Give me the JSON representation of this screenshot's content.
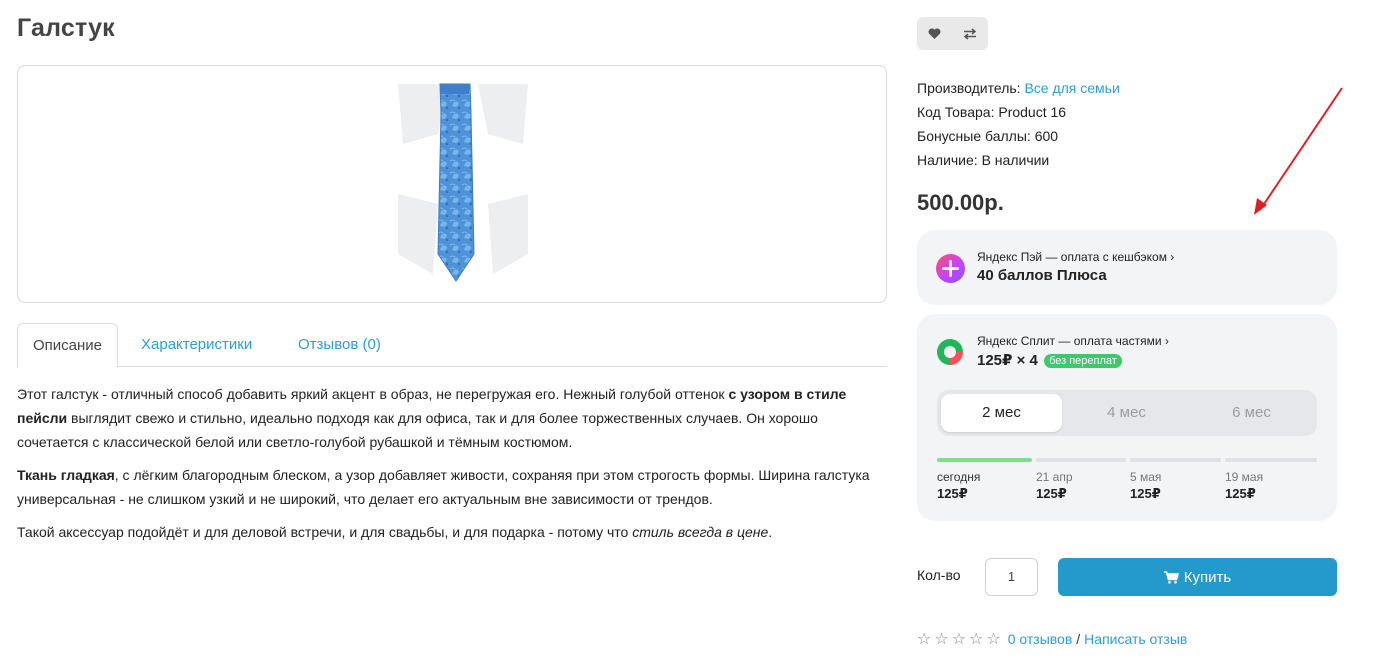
{
  "product": {
    "title": "Галстук"
  },
  "tabs": [
    {
      "label": "Описание"
    },
    {
      "label": "Характеристики"
    },
    {
      "label": "Отзывов (0)"
    }
  ],
  "description": {
    "p1_a": "Этот галстук - отличный способ добавить яркий акцент в образ, не перегружая его. Нежный голубой оттенок ",
    "p1_b": "с узором в стиле пейсли",
    "p1_c": " выглядит свежо и стильно, идеально подходя как для офиса, так и для более торжественных случаев. Он хорошо сочетается с классической белой или светло-голубой рубашкой и тёмным костюмом.",
    "p2_a": "Ткань гладкая",
    "p2_b": ", с лёгким благородным блеском, а узор добавляет живости, сохраняя при этом строгость формы. Ширина галстука универсальная - не слишком узкий и не широкий, что делает его актуальным вне зависимости от трендов.",
    "p3_a": "Такой аксессуар подойдёт и для деловой встречи, и для свадьбы, и для подарка - потому что ",
    "p3_b": "стиль всегда в цене",
    "p3_c": "."
  },
  "info": {
    "manufacturer_label": "Производитель: ",
    "manufacturer_value": "Все для семьи",
    "code_label": "Код Товара: ",
    "code_value": "Product 16",
    "bonus_label": "Бонусные баллы: ",
    "bonus_value": "600",
    "stock_label": "Наличие: ",
    "stock_value": "В наличии"
  },
  "price": "500.00р.",
  "yandex_pay": {
    "subtitle": "Яндекс Пэй — оплата с кешбэком",
    "chevron": "›",
    "main": "40 баллов Плюса"
  },
  "yandex_split": {
    "subtitle": "Яндекс Сплит — оплата частями",
    "chevron": "›",
    "main": "125₽ × 4",
    "badge": "без переплат",
    "periods": [
      "2 мес",
      "4 мес",
      "6 мес"
    ],
    "selected_period": "2 мес",
    "schedule": [
      {
        "date": "сегодня",
        "amount": "125₽",
        "paid": true
      },
      {
        "date": "21 апр",
        "amount": "125₽",
        "paid": false
      },
      {
        "date": "5 мая",
        "amount": "125₽",
        "paid": false
      },
      {
        "date": "19 мая",
        "amount": "125₽",
        "paid": false
      }
    ]
  },
  "purchase": {
    "qty_label": "Кол-во",
    "qty_value": "1",
    "buy_label": "Купить"
  },
  "rating": {
    "stars": "☆☆☆☆☆",
    "reviews_link": "0 отзывов",
    "separator": "/",
    "write_link": "Написать отзыв"
  },
  "colors": {
    "accent": "#2a9fd6",
    "buy_button": "#2399cc",
    "badge": "#3dc86b",
    "annotation_arrow": "#e02020"
  },
  "icons": {
    "wishlist": "heart-icon",
    "compare": "compare-arrows-icon",
    "cart": "cart-icon"
  }
}
